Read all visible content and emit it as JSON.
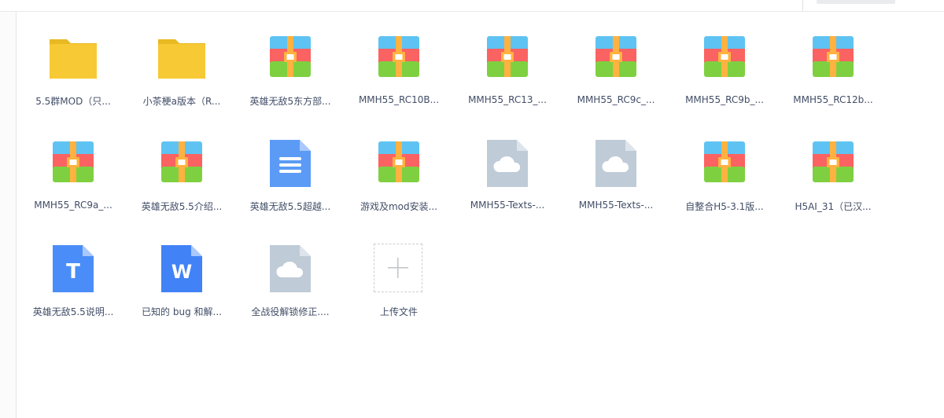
{
  "toolbar": {
    "breadcrumb": ""
  },
  "files": [
    {
      "name": "5.5群MOD（只...",
      "icon": "folder-icon"
    },
    {
      "name": "小茶梗a版本（R...",
      "icon": "folder-icon"
    },
    {
      "name": "英雄无敌5东方部...",
      "icon": "archive-icon"
    },
    {
      "name": "MMH55_RC10B...",
      "icon": "archive-icon"
    },
    {
      "name": "MMH55_RC13_...",
      "icon": "archive-icon"
    },
    {
      "name": "MMH55_RC9c_...",
      "icon": "archive-icon"
    },
    {
      "name": "MMH55_RC9b_...",
      "icon": "archive-icon"
    },
    {
      "name": "MMH55_RC12b...",
      "icon": "archive-icon"
    },
    {
      "name": "MMH55_RC9a_...",
      "icon": "archive-icon"
    },
    {
      "name": "英雄无敌5.5介绍...",
      "icon": "archive-icon"
    },
    {
      "name": "英雄无敌5.5超越...",
      "icon": "document-icon"
    },
    {
      "name": "游戏及mod安装...",
      "icon": "archive-icon"
    },
    {
      "name": "MMH55-Texts-...",
      "icon": "cloud-file-icon"
    },
    {
      "name": "MMH55-Texts-...",
      "icon": "cloud-file-icon"
    },
    {
      "name": "自整合H5-3.1版...",
      "icon": "archive-icon"
    },
    {
      "name": "H5AI_31（已汉...",
      "icon": "archive-icon"
    },
    {
      "name": "英雄无敌5.5说明...",
      "icon": "text-file-icon"
    },
    {
      "name": "已知的 bug 和解...",
      "icon": "word-file-icon"
    },
    {
      "name": "全战役解锁修正....",
      "icon": "cloud-file-icon"
    }
  ],
  "upload": {
    "label": "上传文件",
    "icon": "plus-icon"
  },
  "colors": {
    "folder": "#f7c934",
    "folder_tab": "#e8b922",
    "archive_top": "#5ec3f2",
    "archive_mid": "#fb6262",
    "archive_bottom": "#7fd041",
    "archive_zip": "#ffb23f",
    "doc_blue": "#5b9bf5",
    "text_blue": "#4b8df8",
    "word_blue": "#4182f6",
    "cloud_gray": "#bfcbd7"
  }
}
